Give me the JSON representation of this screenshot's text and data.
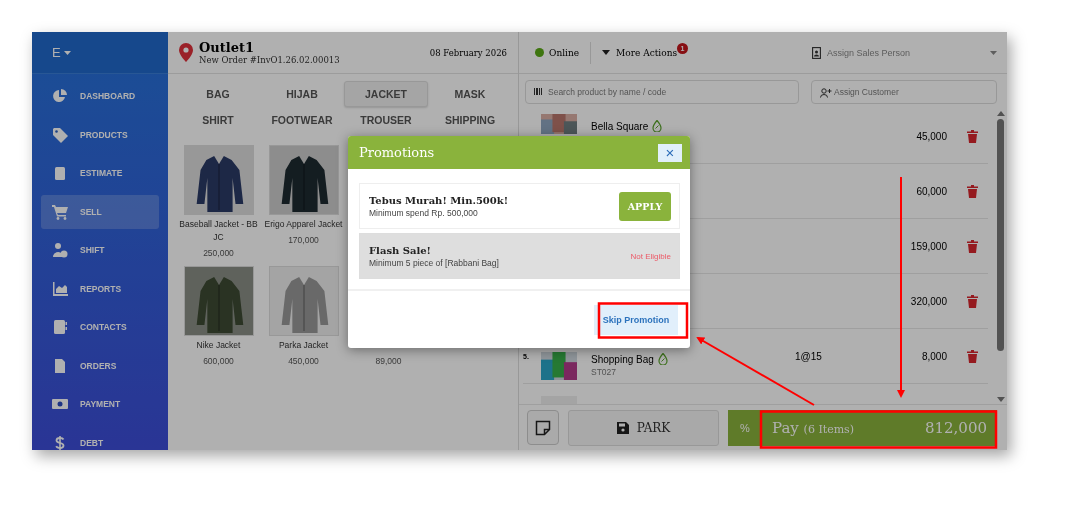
{
  "sidebar": {
    "brand": "E",
    "items": [
      {
        "label": "DASHBOARD",
        "selected": false
      },
      {
        "label": "PRODUCTS",
        "selected": false
      },
      {
        "label": "ESTIMATE",
        "selected": false
      },
      {
        "label": "SELL",
        "selected": true
      },
      {
        "label": "SHIFT",
        "selected": false
      },
      {
        "label": "REPORTS",
        "selected": false
      },
      {
        "label": "CONTACTS",
        "selected": false
      },
      {
        "label": "ORDERS",
        "selected": false
      },
      {
        "label": "PAYMENT",
        "selected": false
      },
      {
        "label": "DEBT",
        "selected": false
      }
    ]
  },
  "header": {
    "outlet": "Outlet1",
    "order": "New Order #InvO1.26.02.00013",
    "date": "08 February 2026"
  },
  "categories": [
    {
      "label": "BAG",
      "selected": false
    },
    {
      "label": "HIJAB",
      "selected": false
    },
    {
      "label": "JACKET",
      "selected": true
    },
    {
      "label": "MASK",
      "selected": false
    },
    {
      "label": "SHIRT",
      "selected": false
    },
    {
      "label": "FOOTWEAR",
      "selected": false
    },
    {
      "label": "TROUSER",
      "selected": false
    },
    {
      "label": "SHIPPING",
      "selected": false
    }
  ],
  "product_rows": [
    [
      {
        "name": "Baseball Jacket - BB JC",
        "price": "250,000"
      },
      {
        "name": "Erigo Apparel Jacket",
        "price": "170,000"
      }
    ],
    [
      {
        "name": "Nike Jacket",
        "price": "600,000"
      },
      {
        "name": "Parka Jacket",
        "price": "450,000"
      },
      {
        "price": "89,000"
      }
    ]
  ],
  "status": {
    "label": "Online",
    "online": true
  },
  "more_actions": {
    "label": "More Actions",
    "badge": "1"
  },
  "sales_person": {
    "placeholder": "Assign Sales Person"
  },
  "search": {
    "placeholder": "Search product by name / code"
  },
  "customer": {
    "placeholder": "Assign Customer"
  },
  "cart": [
    {
      "name": "Bella Square",
      "price": "45,000"
    },
    {
      "price": "60,000"
    },
    {
      "price": "159,000"
    },
    {
      "price": "320,000"
    },
    {
      "number": "5.",
      "name": "Shopping Bag",
      "code": "ST027",
      "qty": "1@15",
      "price": "8,000"
    }
  ],
  "footer": {
    "park": "PARK",
    "discount": "%",
    "pay": "Pay",
    "items": "(6 Items)",
    "total": "812,000"
  },
  "modal": {
    "title": "Promotions",
    "close": "×",
    "promotions": [
      {
        "title": "Tebus Murah! Min.500k!",
        "detail": "Minimum spend Rp. 500,000",
        "eligible": true,
        "action": "APPLY"
      },
      {
        "title": "Flash Sale!",
        "detail": "Minimum 5 piece of [Rabbani Bag]",
        "eligible": false,
        "action": "Not Eligible"
      }
    ],
    "skip": "Skip Promotion"
  }
}
